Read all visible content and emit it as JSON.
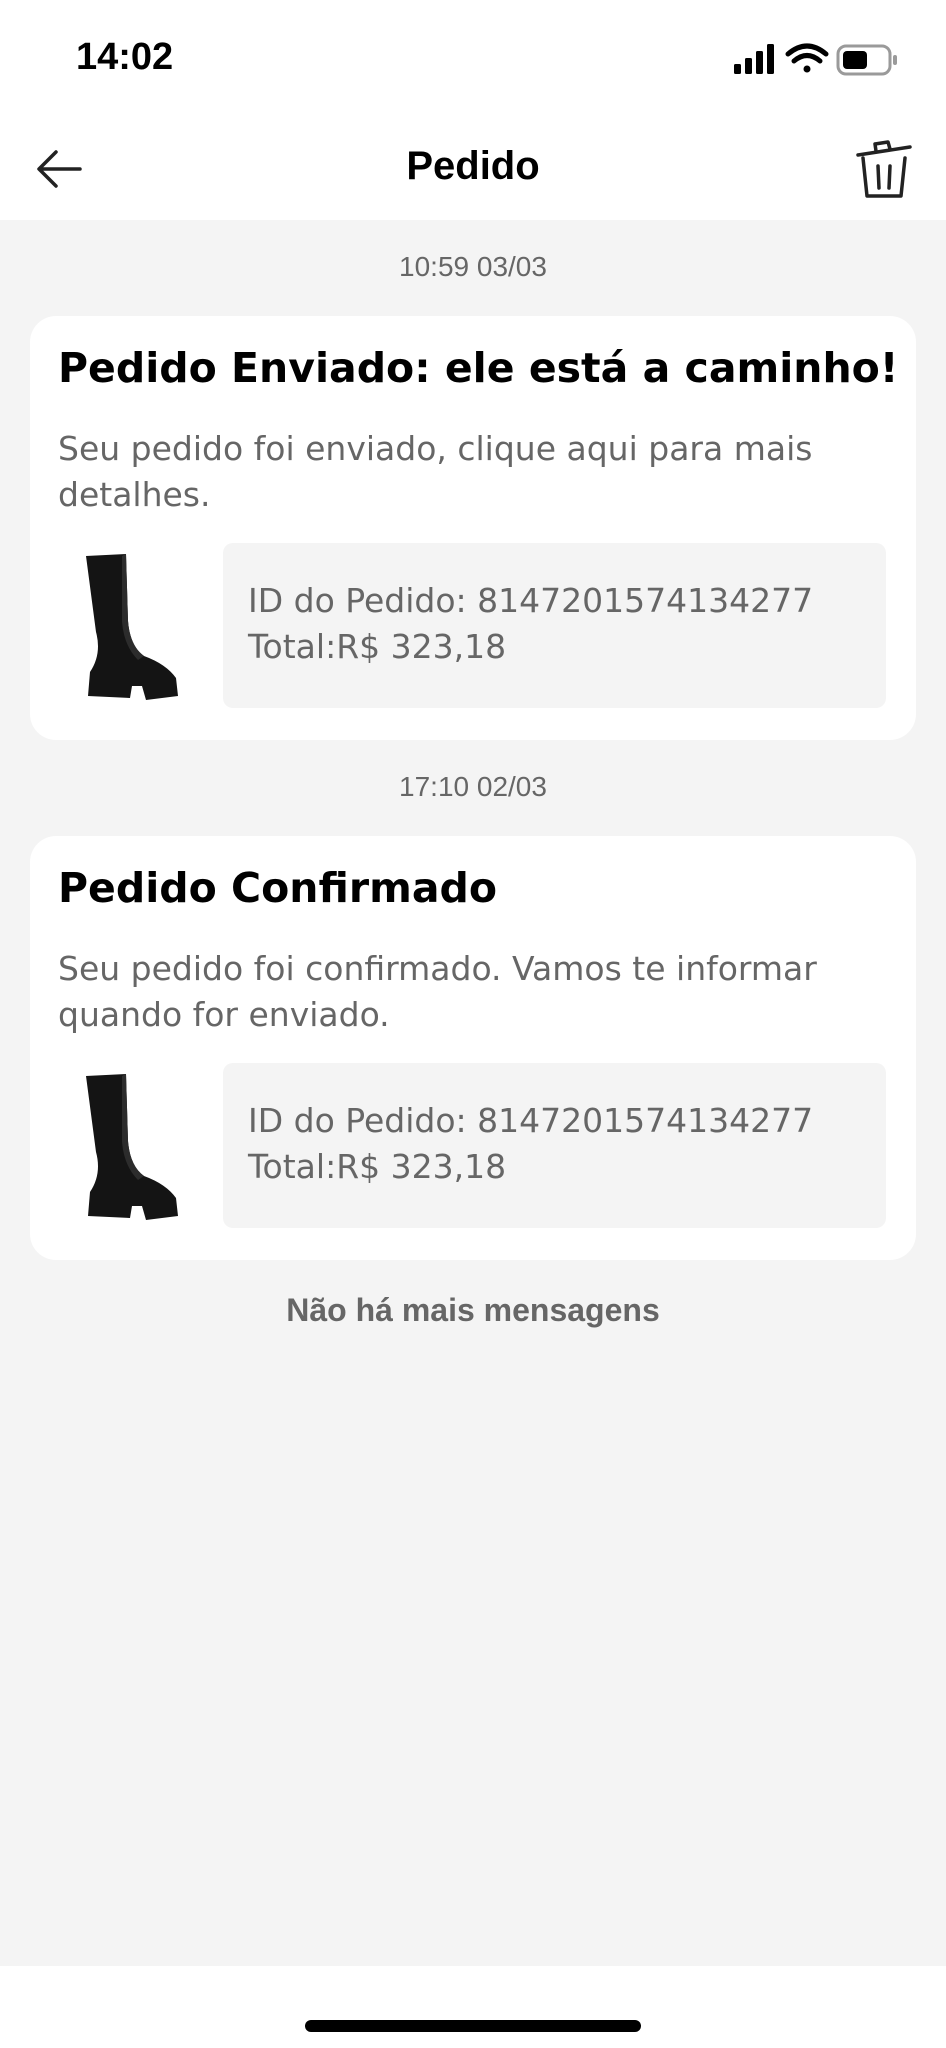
{
  "status_bar": {
    "time": "14:02"
  },
  "header": {
    "title": "Pedido"
  },
  "messages": [
    {
      "timestamp": "10:59 03/03",
      "title": "Pedido Enviado: ele está a caminho!",
      "description": "Seu pedido foi enviado, clique aqui para mais detalhes.",
      "order_id": "ID do Pedido: 8147201574134277",
      "total": "Total:R$ 323,18"
    },
    {
      "timestamp": "17:10 02/03",
      "title": "Pedido Confirmado",
      "description": "Seu pedido foi confirmado. Vamos te informar quando for enviado.",
      "order_id": "ID do Pedido: 8147201574134277",
      "total": "Total:R$ 323,18"
    }
  ],
  "footer": {
    "no_more": "Não há mais mensagens"
  },
  "icons": {
    "back": "arrow-left-icon",
    "delete": "trash-icon",
    "signal": "cellular-signal-icon",
    "wifi": "wifi-icon",
    "battery": "battery-icon",
    "product": "black-platform-boot-image"
  }
}
